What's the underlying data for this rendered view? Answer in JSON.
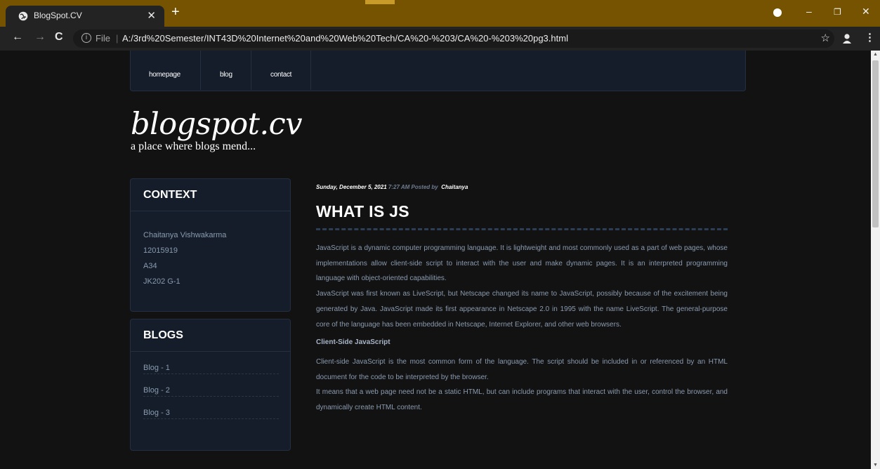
{
  "browser": {
    "tab_title": "BlogSpot.CV",
    "file_label": "File",
    "url": "A:/3rd%20Semester/INT43D%20Internet%20and%20Web%20Tech/CA%20-%203/CA%20-%203%20pg3.html"
  },
  "nav": {
    "items": [
      {
        "label": "homepage"
      },
      {
        "label": "blog"
      },
      {
        "label": "contact"
      }
    ]
  },
  "site": {
    "title": "blogspot.cv",
    "tagline": "a place where blogs mend..."
  },
  "sidebar": {
    "context": {
      "heading": "CONTEXT",
      "lines": [
        "Chaitanya Vishwakarma",
        "12015919",
        "A34",
        "JK202 G-1"
      ]
    },
    "blogs": {
      "heading": "BLOGS",
      "items": [
        "Blog - 1",
        "Blog - 2",
        "Blog - 3"
      ]
    }
  },
  "post": {
    "date": "Sunday, December 5, 2021",
    "time_posted": "7:27 AM Posted by",
    "author": "Chaitanya",
    "title": "WHAT IS JS",
    "p1": "JavaScript is a dynamic computer programming language. It is lightweight and most commonly used as a part of web pages, whose implementations allow client-side script to interact with the user and make dynamic pages. It is an interpreted programming language with object-oriented capabilities.",
    "p2": "JavaScript was first known as LiveScript, but Netscape changed its name to JavaScript, possibly because of the excitement being generated by Java. JavaScript made its first appearance in Netscape 2.0 in 1995 with the name LiveScript. The general-purpose core of the language has been embedded in Netscape, Internet Explorer, and other web browsers.",
    "subheading": "Client-Side JavaScript",
    "p3": "Client-side JavaScript is the most common form of the language. The script should be included in or referenced by an HTML document for the code to be interpreted by the browser.",
    "p4": "It means that a web page need not be a static HTML, but can include programs that interact with the user, control the browser, and dynamically create HTML content."
  },
  "colors": {
    "tabbar": "#755300",
    "page_bg": "#121212",
    "panel_bg": "#141d29",
    "text_muted": "#8a9bb0"
  }
}
